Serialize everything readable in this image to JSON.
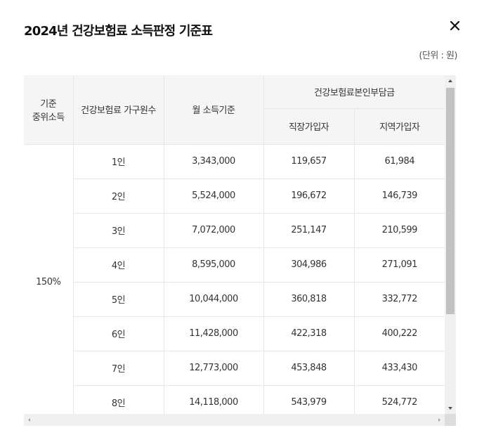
{
  "modal": {
    "title": "2024년 건강보험료 소득판정 기준표",
    "unit": "(단위 : 원)"
  },
  "table": {
    "headers": {
      "median_income_line1": "기준",
      "median_income_line2": "중위소득",
      "household_size": "건강보험료 가구원수",
      "monthly_income": "월 소득기준",
      "premium_group": "건강보험료본인부담금",
      "employee": "직장가입자",
      "regional": "지역가입자"
    },
    "median_income_percent": "150%",
    "rows": [
      {
        "household": "1인",
        "income": "3,343,000",
        "employee": "119,657",
        "regional": "61,984"
      },
      {
        "household": "2인",
        "income": "5,524,000",
        "employee": "196,672",
        "regional": "146,739"
      },
      {
        "household": "3인",
        "income": "7,072,000",
        "employee": "251,147",
        "regional": "210,599"
      },
      {
        "household": "4인",
        "income": "8,595,000",
        "employee": "304,986",
        "regional": "271,091"
      },
      {
        "household": "5인",
        "income": "10,044,000",
        "employee": "360,818",
        "regional": "332,772"
      },
      {
        "household": "6인",
        "income": "11,428,000",
        "employee": "422,318",
        "regional": "400,222"
      },
      {
        "household": "7인",
        "income": "12,773,000",
        "employee": "453,848",
        "regional": "433,430"
      },
      {
        "household": "8인",
        "income": "14,118,000",
        "employee": "543,979",
        "regional": "524,772"
      }
    ]
  },
  "icons": {
    "close": "close-icon",
    "scroll_up": "caret-up-icon",
    "scroll_down": "caret-down-icon",
    "scroll_left": "caret-left-icon",
    "scroll_right": "caret-right-icon"
  },
  "colors": {
    "header_bg": "#f5f5f5",
    "border": "#e6e6e6",
    "scroll_track": "#f0f0f0",
    "scroll_thumb": "#c1c1c1"
  }
}
